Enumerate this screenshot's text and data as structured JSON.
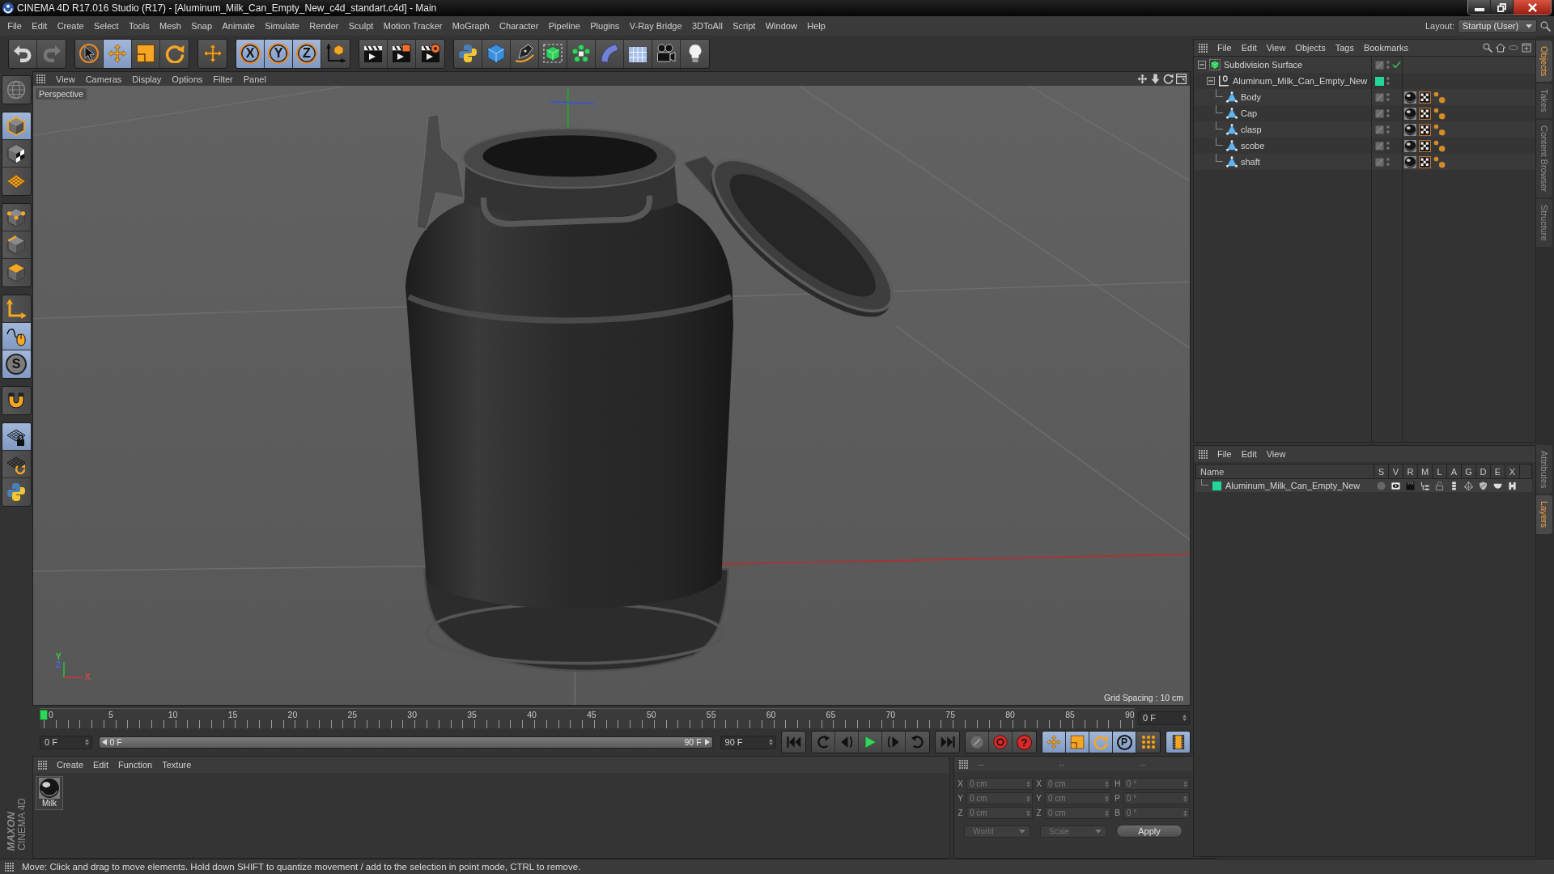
{
  "window": {
    "title": "CINEMA 4D R17.016 Studio (R17) - [Aluminum_Milk_Can_Empty_New_c4d_standart.c4d] - Main"
  },
  "menu_bar": {
    "items": [
      "File",
      "Edit",
      "Create",
      "Select",
      "Tools",
      "Mesh",
      "Snap",
      "Animate",
      "Simulate",
      "Render",
      "Sculpt",
      "Motion Tracker",
      "MoGraph",
      "Character",
      "Pipeline",
      "Plugins",
      "V-Ray Bridge",
      "3DToAll",
      "Script",
      "Window",
      "Help"
    ],
    "layout_label": "Layout:",
    "layout_value": "Startup (User)"
  },
  "toolbar": {
    "groups": [
      [
        {
          "kind": "undo",
          "selected": false,
          "disabled": false
        },
        {
          "kind": "redo",
          "selected": false,
          "disabled": true
        }
      ],
      [
        {
          "kind": "select",
          "selected": false,
          "disabled": false
        },
        {
          "kind": "move",
          "selected": true,
          "disabled": false
        },
        {
          "kind": "scale",
          "selected": false,
          "disabled": false
        },
        {
          "kind": "rotate",
          "selected": false,
          "disabled": false
        }
      ],
      [
        {
          "kind": "recent",
          "selected": false,
          "disabled": false
        }
      ],
      [
        {
          "kind": "axis",
          "label": "X",
          "selected": true,
          "disabled": false
        },
        {
          "kind": "axis",
          "label": "Y",
          "selected": true,
          "disabled": false
        },
        {
          "kind": "axis",
          "label": "Z",
          "selected": true,
          "disabled": false
        },
        {
          "kind": "coordinates",
          "selected": false,
          "disabled": false
        }
      ],
      [
        {
          "kind": "render-view",
          "selected": false,
          "disabled": false
        },
        {
          "kind": "render",
          "selected": false,
          "disabled": false
        },
        {
          "kind": "render-settings",
          "selected": false,
          "disabled": false
        }
      ],
      [
        {
          "kind": "python",
          "selected": false,
          "disabled": false
        },
        {
          "kind": "cube",
          "selected": false,
          "disabled": false
        },
        {
          "kind": "pen",
          "selected": false,
          "disabled": false
        },
        {
          "kind": "subdivision",
          "selected": false,
          "disabled": false
        },
        {
          "kind": "cloner",
          "selected": false,
          "disabled": false
        },
        {
          "kind": "bend",
          "selected": false,
          "disabled": false
        },
        {
          "kind": "floor",
          "selected": false,
          "disabled": false
        },
        {
          "kind": "camera",
          "selected": false,
          "disabled": false
        },
        {
          "kind": "light",
          "selected": false,
          "disabled": false
        }
      ]
    ]
  },
  "tool_palette": {
    "groups": [
      [
        {
          "kind": "make-editable",
          "selected": false
        }
      ],
      [
        {
          "kind": "model",
          "selected": true
        },
        {
          "kind": "texture",
          "selected": false
        },
        {
          "kind": "workplane",
          "selected": false
        }
      ],
      [
        {
          "kind": "points",
          "selected": false
        },
        {
          "kind": "edges",
          "selected": false
        },
        {
          "kind": "polygons",
          "selected": false
        }
      ],
      [
        {
          "kind": "axis-mode",
          "selected": false
        },
        {
          "kind": "tweak",
          "selected": true
        },
        {
          "kind": "solo",
          "label": "S",
          "selected": true
        }
      ],
      [
        {
          "kind": "snap",
          "selected": false
        }
      ],
      [
        {
          "kind": "workplane-lock",
          "selected": true
        },
        {
          "kind": "workplane-rotate",
          "selected": false
        },
        {
          "kind": "python",
          "selected": false
        }
      ]
    ]
  },
  "viewport": {
    "menu": [
      "View",
      "Cameras",
      "Display",
      "Options",
      "Filter",
      "Panel"
    ],
    "camera": "Perspective",
    "axis_labels": {
      "y": "Y",
      "z": "Z",
      "x": "X"
    },
    "grid_spacing": "Grid Spacing : 10 cm"
  },
  "timeline": {
    "ticks": [
      "0",
      "5",
      "10",
      "15",
      "20",
      "25",
      "30",
      "35",
      "40",
      "45",
      "50",
      "55",
      "60",
      "65",
      "70",
      "75",
      "80",
      "85",
      "90"
    ],
    "level": 0,
    "frame": "0 F"
  },
  "transport": {
    "start_field": "0 F",
    "range_start": "0 F",
    "range_end": "90 F",
    "level": 1,
    "end_field": "90 F",
    "groups": [
      [
        {
          "kind": "first",
          "selected": false
        }
      ],
      [
        {
          "kind": "prev-key",
          "selected": false
        },
        {
          "kind": "prev-frame",
          "selected": false
        },
        {
          "kind": "play",
          "selected": false
        },
        {
          "kind": "next-frame",
          "selected": false
        },
        {
          "kind": "next-key",
          "selected": false
        }
      ],
      [
        {
          "kind": "last",
          "selected": false
        }
      ],
      [
        {
          "kind": "record",
          "selected": false
        },
        {
          "kind": "autokey",
          "selected": false
        },
        {
          "kind": "key-selection",
          "label": "?",
          "selected": false
        }
      ],
      [
        {
          "kind": "key-move",
          "selected": true
        },
        {
          "kind": "key-scale",
          "selected": true
        },
        {
          "kind": "key-rotate",
          "selected": true
        },
        {
          "kind": "key-param",
          "label": "P",
          "selected": true
        },
        {
          "kind": "key-pla",
          "selected": false
        }
      ],
      [
        {
          "kind": "timeline",
          "selected": true
        }
      ]
    ]
  },
  "material_manager": {
    "menu": [
      "Create",
      "Edit",
      "Function",
      "Texture"
    ],
    "materials": [
      {
        "name": "Milk",
        "selected": false
      }
    ]
  },
  "coordinates": {
    "headers": [
      "--",
      "--",
      "--"
    ],
    "rows": [
      {
        "position_axis": "X",
        "position": "0 cm",
        "size_axis": "X",
        "size": "0 cm",
        "rotation_axis": "H",
        "rotation": "0 °"
      },
      {
        "position_axis": "Y",
        "position": "0 cm",
        "size_axis": "Y",
        "size": "0 cm",
        "rotation_axis": "P",
        "rotation": "0 °"
      },
      {
        "position_axis": "Z",
        "position": "0 cm",
        "size_axis": "Z",
        "size": "0 cm",
        "rotation_axis": "B",
        "rotation": "0 °"
      }
    ],
    "space": "World",
    "size_mode": "Scale",
    "apply": "Apply"
  },
  "object_manager": {
    "menu": [
      "File",
      "Edit",
      "View",
      "Objects",
      "Tags",
      "Bookmarks"
    ],
    "objects": [
      {
        "name": "Subdivision Surface",
        "kind": "subdivision",
        "expanded": true,
        "checked": true,
        "children": [
          {
            "name": "Aluminum_Milk_Can_Empty_New",
            "kind": "null",
            "expanded": true,
            "color": "#22d69b",
            "children": [
              {
                "name": "Body",
                "kind": "polygon",
                "tags": [
                  {
                    "kind": "material"
                  },
                  {
                    "kind": "uvw"
                  },
                  {
                    "kind": "selection"
                  }
                ]
              },
              {
                "name": "Cap",
                "kind": "polygon",
                "tags": [
                  {
                    "kind": "material"
                  },
                  {
                    "kind": "uvw"
                  },
                  {
                    "kind": "selection"
                  }
                ]
              },
              {
                "name": "clasp",
                "kind": "polygon",
                "tags": [
                  {
                    "kind": "material"
                  },
                  {
                    "kind": "uvw"
                  },
                  {
                    "kind": "selection"
                  }
                ]
              },
              {
                "name": "scobe",
                "kind": "polygon",
                "tags": [
                  {
                    "kind": "material"
                  },
                  {
                    "kind": "uvw"
                  },
                  {
                    "kind": "selection"
                  }
                ]
              },
              {
                "name": "shaft",
                "kind": "polygon",
                "tags": [
                  {
                    "kind": "material"
                  },
                  {
                    "kind": "uvw"
                  },
                  {
                    "kind": "selection"
                  }
                ]
              }
            ]
          }
        ]
      }
    ]
  },
  "layer_manager": {
    "menu": [
      "File",
      "Edit",
      "View"
    ],
    "columns": [
      "Name",
      "S",
      "V",
      "R",
      "M",
      "L",
      "A",
      "G",
      "D",
      "E",
      "X"
    ],
    "layers": [
      {
        "name": "Aluminum_Milk_Can_Empty_New",
        "color": "#22d69b",
        "switches": [
          {
            "kind": "solo",
            "on": false
          },
          {
            "kind": "view",
            "on": true
          },
          {
            "kind": "render",
            "on": true
          },
          {
            "kind": "manager",
            "on": true
          },
          {
            "kind": "lock",
            "on": false
          },
          {
            "kind": "animation",
            "on": true
          },
          {
            "kind": "generators",
            "on": true
          },
          {
            "kind": "deformers",
            "on": true
          },
          {
            "kind": "expressions",
            "on": true
          },
          {
            "kind": "xref",
            "on": true
          }
        ]
      }
    ]
  },
  "side_tabs": {
    "upper": [
      {
        "label": "Objects",
        "selected": true
      },
      {
        "label": "Takes",
        "selected": false
      },
      {
        "label": "Content Browser",
        "selected": false
      },
      {
        "label": "Structure",
        "selected": false
      }
    ],
    "lower": [
      {
        "label": "Attributes",
        "selected": false
      },
      {
        "label": "Layers",
        "selected": true
      }
    ]
  },
  "logo": {
    "brand": "MAXON",
    "product": "CINEMA 4D"
  },
  "status_bar": {
    "text": "Move: Click and drag to move elements. Hold down SHIFT to quantize movement / add to the selection in point mode, CTRL to remove."
  }
}
